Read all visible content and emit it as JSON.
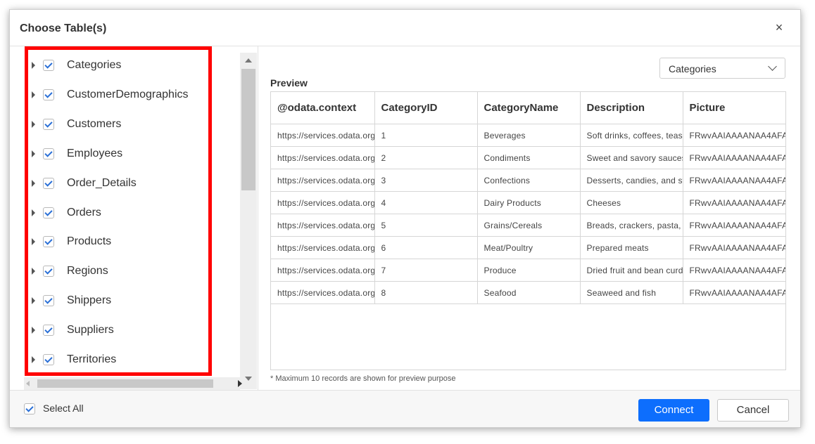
{
  "dialog": {
    "title": "Choose Table(s)",
    "close_glyph": "×"
  },
  "tree": {
    "items": [
      {
        "label": "Categories",
        "checked": true
      },
      {
        "label": "CustomerDemographics",
        "checked": true
      },
      {
        "label": "Customers",
        "checked": true
      },
      {
        "label": "Employees",
        "checked": true
      },
      {
        "label": "Order_Details",
        "checked": true
      },
      {
        "label": "Orders",
        "checked": true
      },
      {
        "label": "Products",
        "checked": true
      },
      {
        "label": "Regions",
        "checked": true
      },
      {
        "label": "Shippers",
        "checked": true
      },
      {
        "label": "Suppliers",
        "checked": true
      },
      {
        "label": "Territories",
        "checked": true
      }
    ]
  },
  "preview": {
    "label": "Preview",
    "table_select": "Categories",
    "columns": [
      "@odata.context",
      "CategoryID",
      "CategoryName",
      "Description",
      "Picture"
    ],
    "rows": [
      [
        "https://services.odata.org",
        "1",
        "Beverages",
        "Soft drinks, coffees, teas, beers, and ales",
        "FRwvAAIAAAANAA4AFA"
      ],
      [
        "https://services.odata.org",
        "2",
        "Condiments",
        "Sweet and savory sauces, relishes",
        "FRwvAAIAAAANAA4AFA"
      ],
      [
        "https://services.odata.org",
        "3",
        "Confections",
        "Desserts, candies, and sweet breads",
        "FRwvAAIAAAANAA4AFA"
      ],
      [
        "https://services.odata.org",
        "4",
        "Dairy Products",
        "Cheeses",
        "FRwvAAIAAAANAA4AFA"
      ],
      [
        "https://services.odata.org",
        "5",
        "Grains/Cereals",
        "Breads, crackers, pasta, and cereal",
        "FRwvAAIAAAANAA4AFA"
      ],
      [
        "https://services.odata.org",
        "6",
        "Meat/Poultry",
        "Prepared meats",
        "FRwvAAIAAAANAA4AFA"
      ],
      [
        "https://services.odata.org",
        "7",
        "Produce",
        "Dried fruit and bean curd",
        "FRwvAAIAAAANAA4AFA"
      ],
      [
        "https://services.odata.org",
        "8",
        "Seafood",
        "Seaweed and fish",
        "FRwvAAIAAAANAA4AFA"
      ]
    ],
    "note": "* Maximum 10 records are shown for preview purpose"
  },
  "footer": {
    "select_all_label": "Select All",
    "select_all_checked": true,
    "connect_label": "Connect",
    "cancel_label": "Cancel"
  },
  "colors": {
    "primary": "#0d6efd",
    "highlight": "#ff0000",
    "check": "#2a6fd6"
  }
}
